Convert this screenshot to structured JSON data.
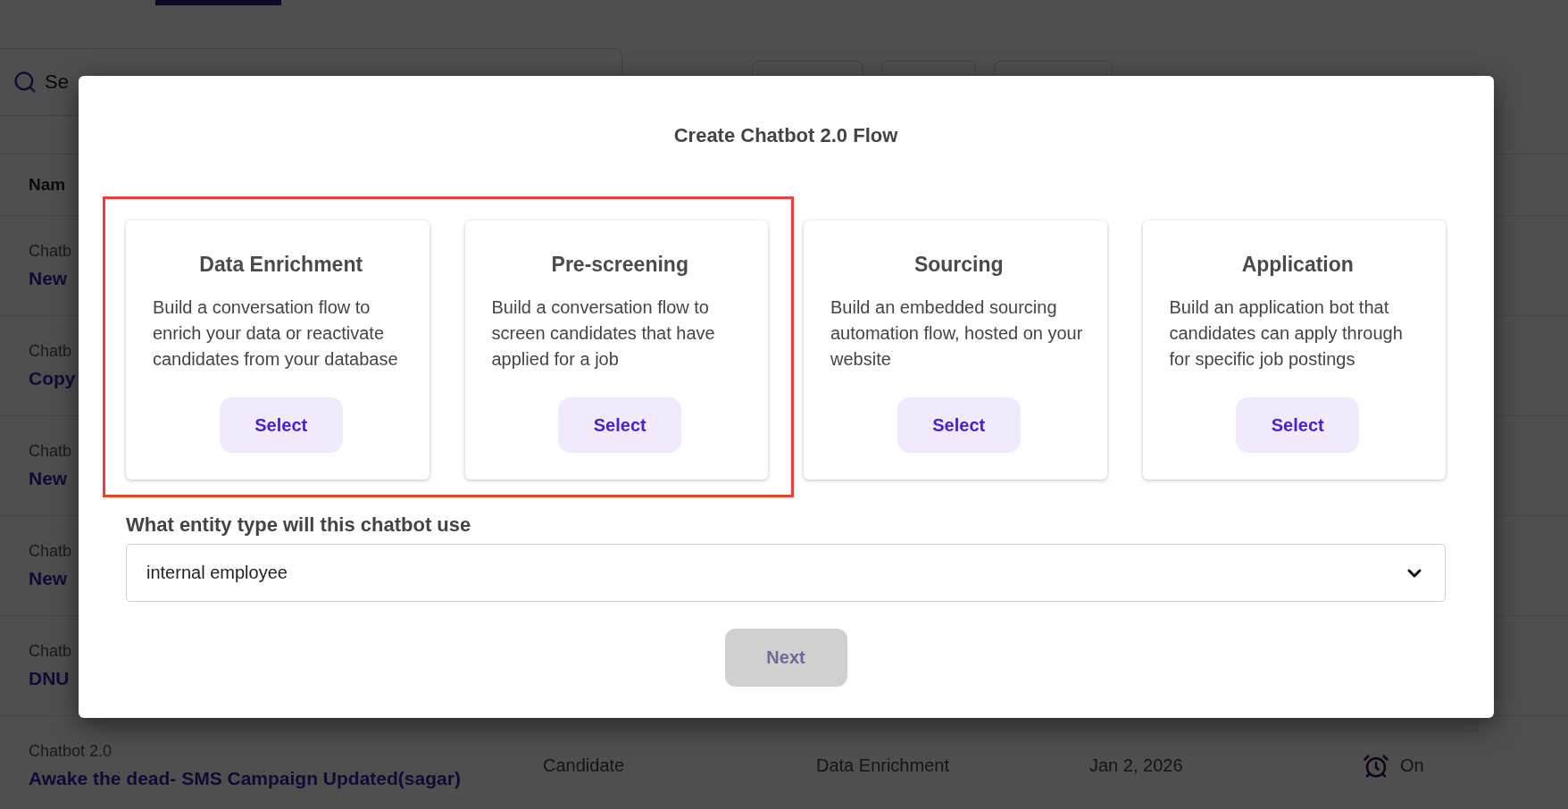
{
  "background": {
    "search": {
      "placeholder": "Se"
    },
    "table": {
      "columns": [
        "Nam"
      ],
      "rows": [
        {
          "type": "Chatb",
          "name": "New"
        },
        {
          "type": "Chatb",
          "name": "Copy"
        },
        {
          "type": "Chatb",
          "name": "New"
        },
        {
          "type": "Chatb",
          "name": "New"
        },
        {
          "type": "Chatb",
          "name": "DNU"
        },
        {
          "type": "Chatbot 2.0",
          "name": "Awake the dead- SMS Campaign Updated(sagar)",
          "entity": "Candidate",
          "flow": "Data Enrichment",
          "date": "Jan 2, 2026",
          "status": "On"
        }
      ]
    }
  },
  "dialog": {
    "title": "Create Chatbot 2.0 Flow",
    "cards": [
      {
        "title": "Data Enrichment",
        "description": "Build a conversation flow to enrich your data or reactivate candidates from your database",
        "button": "Select",
        "highlighted": true
      },
      {
        "title": "Pre-screening",
        "description": "Build a conversation flow to screen candidates that have applied for a job",
        "button": "Select",
        "highlighted": true
      },
      {
        "title": "Sourcing",
        "description": "Build an embedded sourcing automation flow, hosted on your website",
        "button": "Select",
        "highlighted": false
      },
      {
        "title": "Application",
        "description": "Build an application bot that candidates can apply through for specific job postings",
        "button": "Select",
        "highlighted": false
      }
    ],
    "entity_label": "What entity type will this chatbot use",
    "entity_select": {
      "value": "internal employee"
    },
    "next_button": {
      "label": "Next",
      "disabled": true
    }
  }
}
